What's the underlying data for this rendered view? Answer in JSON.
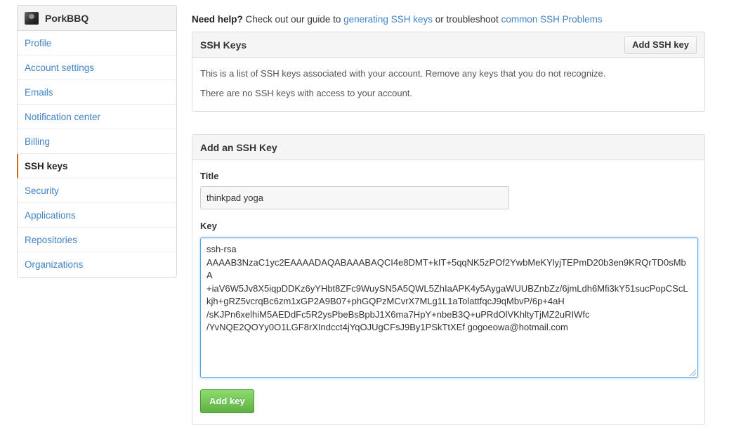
{
  "sidebar": {
    "username": "PorkBBQ",
    "items": [
      {
        "label": "Profile"
      },
      {
        "label": "Account settings"
      },
      {
        "label": "Emails"
      },
      {
        "label": "Notification center"
      },
      {
        "label": "Billing"
      },
      {
        "label": "SSH keys",
        "selected": true
      },
      {
        "label": "Security"
      },
      {
        "label": "Applications"
      },
      {
        "label": "Repositories"
      },
      {
        "label": "Organizations"
      }
    ]
  },
  "help": {
    "prefix": "Need help?",
    "text1": "Check out our guide to",
    "link1": "generating SSH keys",
    "text2": "or troubleshoot",
    "link2": "common SSH Problems"
  },
  "ssh_keys": {
    "title": "SSH Keys",
    "add_button": "Add SSH key",
    "description": "This is a list of SSH keys associated with your account. Remove any keys that you do not recognize.",
    "empty_message": "There are no SSH keys with access to your account."
  },
  "add_key": {
    "title": "Add an SSH Key",
    "title_label": "Title",
    "title_value": "thinkpad yoga",
    "key_label": "Key",
    "key_value": "ssh-rsa\nAAAAB3NzaC1yc2EAAAADAQABAAABAQCI4e8DMT+kIT+5qqNK5zPOf2YwbMeKYlyjTEPmD20b3en9KRQrTD0sMbA\n+iaV6W5Jv8X5iqpDDKz6yYHbt8ZFc9WuySN5A5QWL5ZhIaAPK4y5AygaWUUBZnbZz/6jmLdh6Mfi3kY51sucPopCScL\nkjh+gRZ5vcrqBc6zm1xGP2A9B07+phGQPzMCvrX7MLg1L1aTolattfqcJ9qMbvP/6p+4aH\n/sKJPn6xelhiM5AEDdFc5R2ysPbeBsBpbJ1X6ma7HpY+nbeB3Q+uPRdOlVKhltyTjMZ2uRIWfc\n/YvNQE2QOYy0O1LGF8rXIndcct4jYqOJUgCFsJ9By1PSkTtXEf gogoeowa@hotmail.com",
    "submit_button": "Add key"
  },
  "colors": {
    "link": "#4183c4",
    "selected_accent": "#d26911",
    "green_button": "#60b044"
  }
}
